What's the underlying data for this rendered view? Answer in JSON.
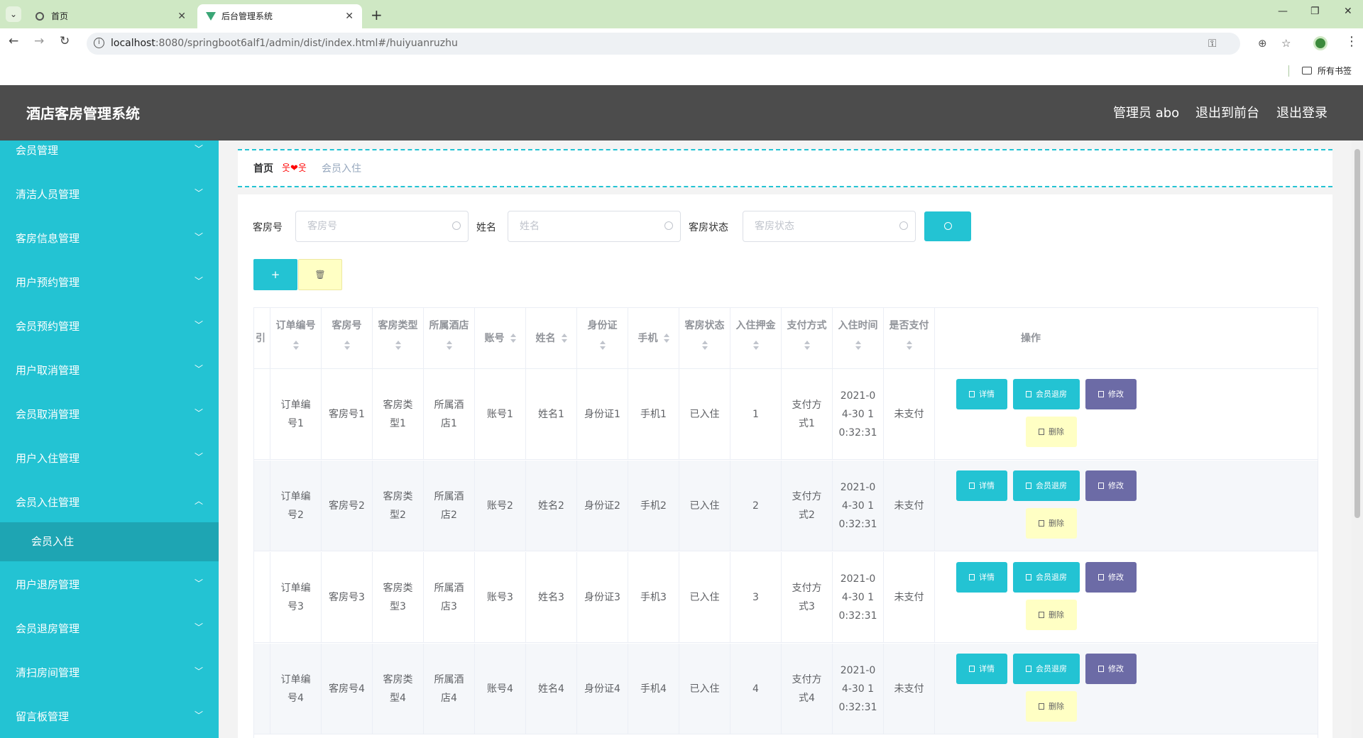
{
  "browser": {
    "tabs": [
      {
        "title": "首页"
      },
      {
        "title": "后台管理系统"
      }
    ],
    "url_host": "localhost",
    "url_path": ":8080/springboot6alf1/admin/dist/index.html#/huiyuanruzhu",
    "bookmarks_label": "所有书签"
  },
  "header": {
    "title": "酒店客房管理系统",
    "admin": "管理员 abo",
    "to_front": "退出到前台",
    "logout": "退出登录"
  },
  "sidebar": {
    "items": [
      {
        "label": "会员管理"
      },
      {
        "label": "清洁人员管理"
      },
      {
        "label": "客房信息管理"
      },
      {
        "label": "用户预约管理"
      },
      {
        "label": "会员预约管理"
      },
      {
        "label": "用户取消管理"
      },
      {
        "label": "会员取消管理"
      },
      {
        "label": "用户入住管理"
      },
      {
        "label": "会员入住管理"
      },
      {
        "label": "用户退房管理"
      },
      {
        "label": "会员退房管理"
      },
      {
        "label": "清扫房间管理"
      },
      {
        "label": "留言板管理"
      }
    ],
    "active_sub": "会员入住"
  },
  "breadcrumb": {
    "home": "首页",
    "separator": "웃❤웃",
    "current": "会员入住"
  },
  "search": {
    "room_no_label": "客房号",
    "room_no_placeholder": "客房号",
    "name_label": "姓名",
    "name_placeholder": "姓名",
    "status_label": "客房状态",
    "status_placeholder": "客房状态"
  },
  "toolbar": {
    "add": "+",
    "delete": "🗑"
  },
  "table": {
    "first_col_fragment": "引",
    "headers": [
      "订单编号",
      "客房号",
      "客房类型",
      "所属酒店",
      "账号",
      "姓名",
      "身份证",
      "手机",
      "客房状态",
      "入住押金",
      "支付方式",
      "入住时间",
      "是否支付",
      "操作"
    ],
    "rows": [
      {
        "order": "订单编号1",
        "room": "客房号1",
        "type": "客房类型1",
        "hotel": "所属酒店1",
        "account": "账号1",
        "name": "姓名1",
        "idcard": "身份证1",
        "phone": "手机1",
        "status": "已入住",
        "deposit": "1",
        "payment": "支付方式1",
        "checkin": "2021-04-30 10:32:31",
        "paid": "未支付"
      },
      {
        "order": "订单编号2",
        "room": "客房号2",
        "type": "客房类型2",
        "hotel": "所属酒店2",
        "account": "账号2",
        "name": "姓名2",
        "idcard": "身份证2",
        "phone": "手机2",
        "status": "已入住",
        "deposit": "2",
        "payment": "支付方式2",
        "checkin": "2021-04-30 10:32:31",
        "paid": "未支付"
      },
      {
        "order": "订单编号3",
        "room": "客房号3",
        "type": "客房类型3",
        "hotel": "所属酒店3",
        "account": "账号3",
        "name": "姓名3",
        "idcard": "身份证3",
        "phone": "手机3",
        "status": "已入住",
        "deposit": "3",
        "payment": "支付方式3",
        "checkin": "2021-04-30 10:32:31",
        "paid": "未支付"
      },
      {
        "order": "订单编号4",
        "room": "客房号4",
        "type": "客房类型4",
        "hotel": "所属酒店4",
        "account": "账号4",
        "name": "姓名4",
        "idcard": "身份证4",
        "phone": "手机4",
        "status": "已入住",
        "deposit": "4",
        "payment": "支付方式4",
        "checkin": "2021-04-30 10:32:31",
        "paid": "未支付"
      }
    ],
    "actions": {
      "detail": "详情",
      "checkout": "会员退房",
      "edit": "修改",
      "remove": "删除"
    }
  },
  "colors": {
    "accent": "#23c3d3",
    "header_bg": "#4c4c4c",
    "edit_btn": "#6c6ba6",
    "delete_btn": "#ffffc4"
  }
}
